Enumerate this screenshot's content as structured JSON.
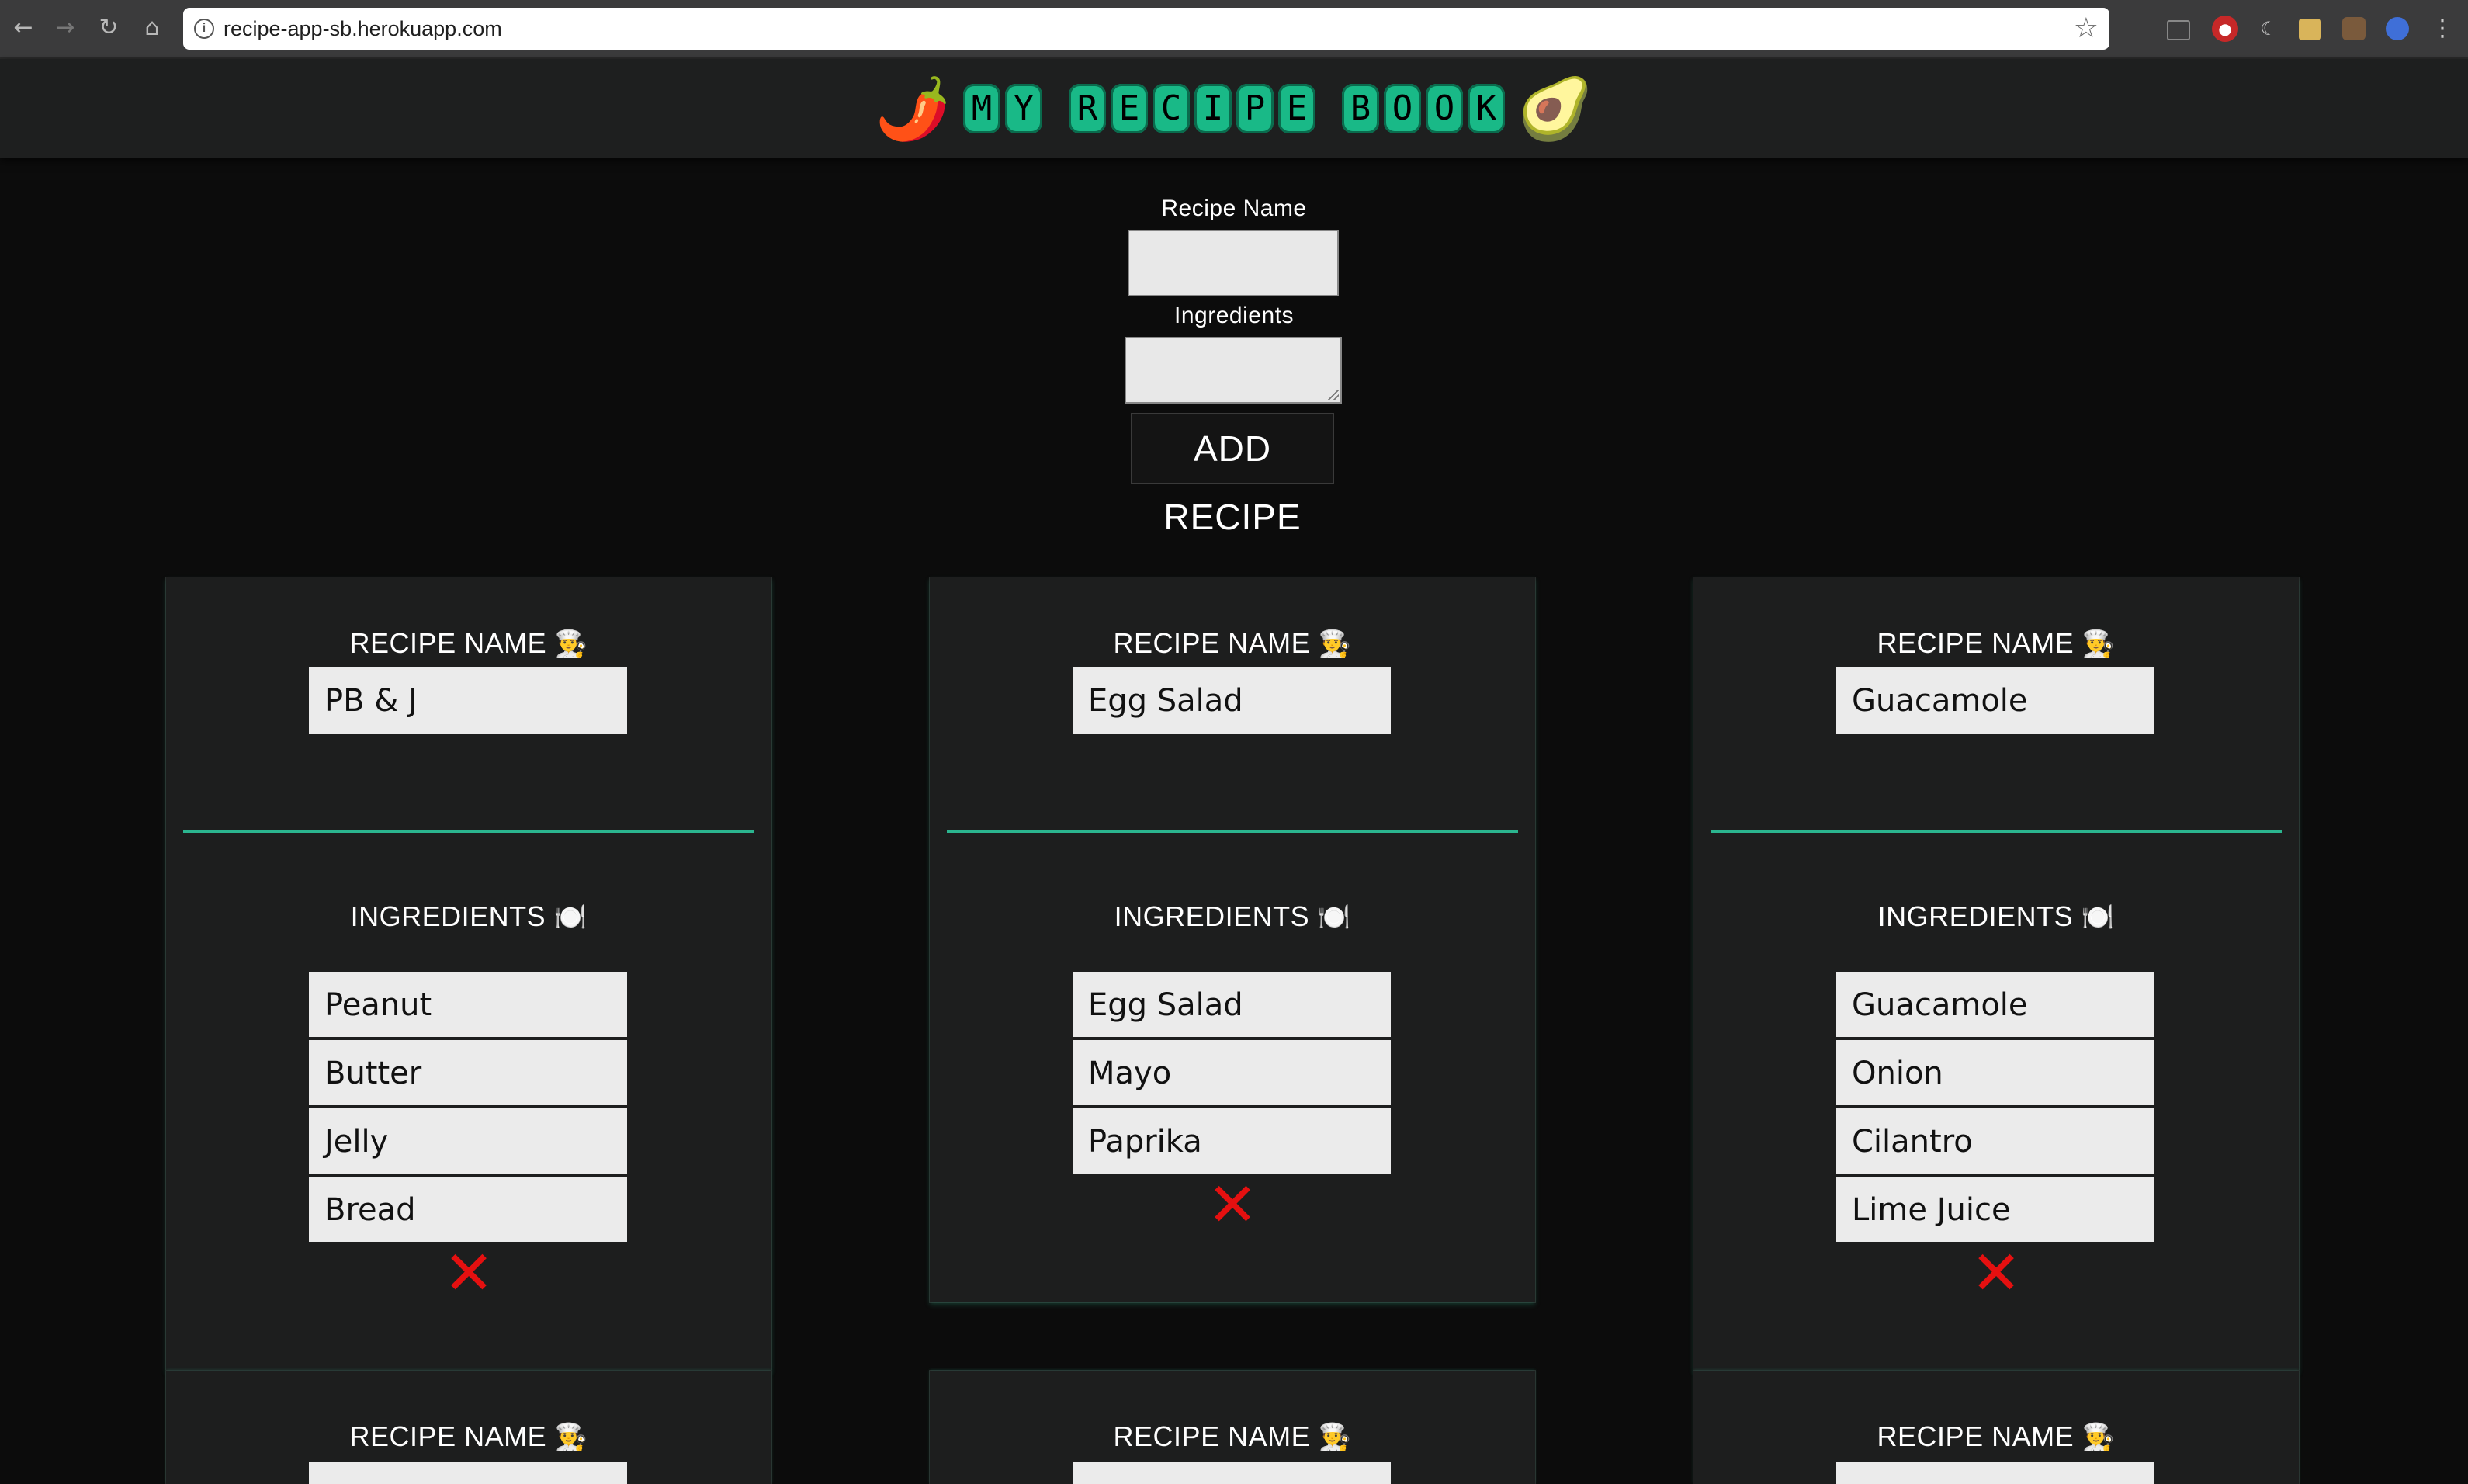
{
  "browser": {
    "url": "recipe-app-sb.herokuapp.com",
    "back_icon": "←",
    "forward_icon": "→",
    "reload_icon": "↻",
    "home_icon": "⌂",
    "star_icon": "☆"
  },
  "header": {
    "logo_left_emoji": "🌶️",
    "logo_right_emoji": "🥑",
    "logo_words": [
      "MY",
      "RECIPE",
      "BOOK"
    ]
  },
  "form": {
    "recipe_name_label": "Recipe Name",
    "recipe_name_value": "",
    "ingredients_label": "Ingredients",
    "ingredients_value": "",
    "add_button": "ADD RECIPE"
  },
  "card_labels": {
    "recipe_name": "RECIPE NAME",
    "chef_emoji": "👨‍🍳",
    "ingredients": "INGREDIENTS",
    "plate_emoji": "🍽️",
    "delete_icon": "✕"
  },
  "recipes": [
    {
      "name": "PB & J",
      "ingredients": [
        "Peanut",
        "Butter",
        "Jelly",
        "Bread"
      ]
    },
    {
      "name": "Egg Salad",
      "ingredients": [
        "Egg Salad",
        "Mayo",
        "Paprika"
      ]
    },
    {
      "name": "Guacamole",
      "ingredients": [
        "Guacamole",
        "Onion",
        "Cilantro",
        "Lime Juice"
      ]
    }
  ],
  "colors": {
    "accent": "#19b987",
    "divider": "#2bb58f",
    "delete": "#e51010",
    "card_bg": "#1d1e1e",
    "page_bg": "#0c0c0c"
  }
}
